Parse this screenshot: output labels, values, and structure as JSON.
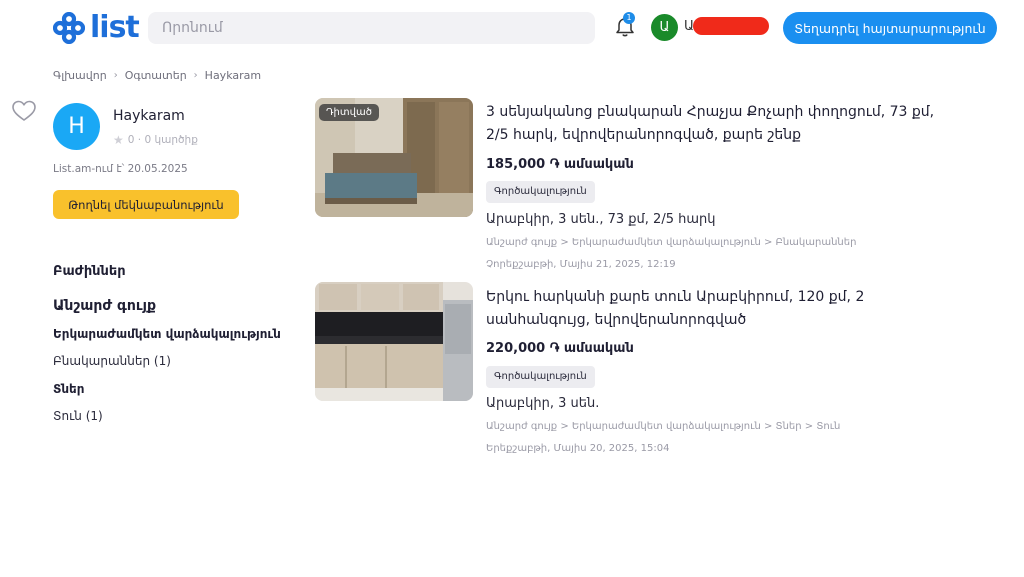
{
  "header": {
    "logo_text": "list",
    "search_placeholder": "Որոնում",
    "notification_count": "1",
    "user_initial": "Ա",
    "user_name_visible": "Ա",
    "post_button": "Տեղադրել հայտարարություն",
    "brand_color": "#1e6fd9"
  },
  "breadcrumb": [
    "Գլխավոր",
    "Օգտատեր",
    "Haykaram"
  ],
  "profile": {
    "initial": "H",
    "name": "Haykaram",
    "rating_text": "0 · 0 կարծիք",
    "member_since": "List.am-ում է՝ 20.05.2025",
    "comment_button": "Թողնել մեկնաբանություն"
  },
  "categories": {
    "title": "Բաժիններ",
    "group": "Անշարժ գույք",
    "sub1": "Երկարաժամկետ վարձակալություն",
    "item1": "Բնակարաններ (1)",
    "sub2": "Տներ",
    "item2": "Տուն (1)"
  },
  "listings": [
    {
      "badge": "Դիտված",
      "title": "3 սենյականոց բնակարան Հրաչյա Քոչարի փողոցում, 73 քմ, 2/5 հարկ, եվրովերանորոգված, քարե շենք",
      "price": "185,000 ֏ ամսական",
      "tag": "Գործակալություն",
      "details": "Արաբկիր, 3 սեն., 73 քմ, 2/5 հարկ",
      "path": "Անշարժ գույք > Երկարաժամկետ վարձակալություն > Բնակարաններ",
      "date": "Չորեքշաբթի, Մայիս 21, 2025, 12:19"
    },
    {
      "title": "Երկու հարկանի քարե տուն Արաբկիրում, 120 քմ, 2 սանհանգույց, եվրովերանորոգված",
      "price": "220,000 ֏ ամսական",
      "tag": "Գործակալություն",
      "details": "Արաբկիր, 3 սեն.",
      "path": "Անշարժ գույք > Երկարաժամկետ վարձակալություն > Տներ > Տուն",
      "date": "Երեքշաբթի, Մայիս 20, 2025, 15:04"
    }
  ]
}
